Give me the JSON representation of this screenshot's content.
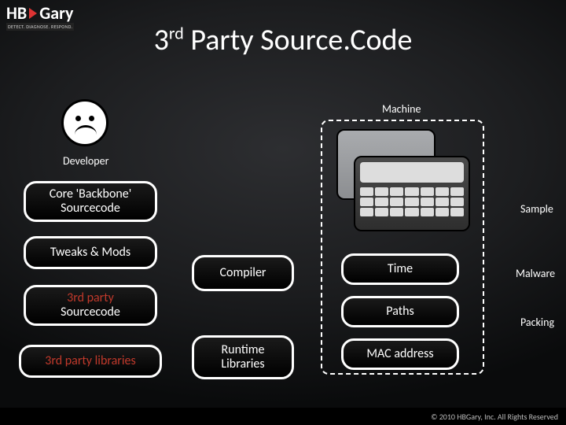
{
  "logo": {
    "hb": "HB",
    "gary": "Gary",
    "sub": "DETECT. DIAGNOSE. RESPOND."
  },
  "title_pre": "3",
  "title_sup": "rd",
  "title_post": " Party Source.Code",
  "labels": {
    "developer": "Developer",
    "machine": "Machine",
    "sample": "Sample",
    "malware": "Malware",
    "packing": "Packing"
  },
  "left_boxes": {
    "core_l1": "Core 'Backbone'",
    "core_l2": "Sourcecode",
    "tweaks": "Tweaks & Mods",
    "third_l1": "3rd party",
    "third_l2": "Sourcecode",
    "thirdlib": "3rd party libraries"
  },
  "mid_boxes": {
    "compiler": "Compiler",
    "runtime_l1": "Runtime",
    "runtime_l2": "Libraries"
  },
  "machine_boxes": {
    "time": "Time",
    "paths": "Paths",
    "mac": "MAC address"
  },
  "footer": "© 2010 HBGary, Inc. All Rights Reserved"
}
